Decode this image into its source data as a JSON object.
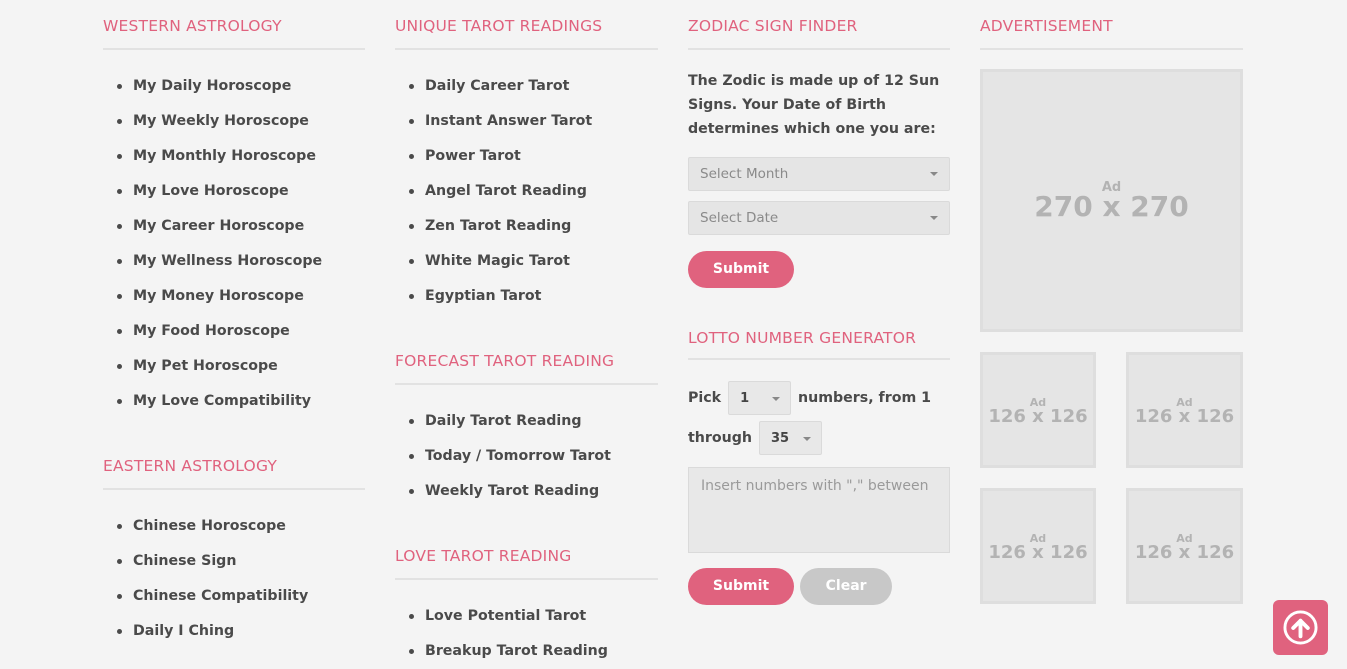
{
  "western": {
    "title": "WESTERN ASTROLOGY",
    "items": [
      "My Daily Horoscope",
      "My Weekly Horoscope",
      "My Monthly Horoscope",
      "My Love Horoscope",
      "My Career Horoscope",
      "My Wellness Horoscope",
      "My Money Horoscope",
      "My Food Horoscope",
      "My Pet Horoscope",
      "My Love Compatibility"
    ]
  },
  "eastern": {
    "title": "EASTERN ASTROLOGY",
    "items": [
      "Chinese Horoscope",
      "Chinese Sign",
      "Chinese Compatibility",
      "Daily I Ching"
    ]
  },
  "unique_tarot": {
    "title": "UNIQUE TAROT READINGS",
    "items": [
      "Daily Career Tarot",
      "Instant Answer Tarot",
      "Power Tarot",
      "Angel Tarot Reading",
      "Zen Tarot Reading",
      "White Magic Tarot",
      "Egyptian Tarot"
    ]
  },
  "forecast_tarot": {
    "title": "FORECAST TAROT READING",
    "items": [
      "Daily Tarot Reading",
      "Today / Tomorrow Tarot",
      "Weekly Tarot Reading"
    ]
  },
  "love_tarot": {
    "title": "LOVE TAROT READING",
    "items": [
      "Love Potential Tarot",
      "Breakup Tarot Reading"
    ]
  },
  "zodiac_finder": {
    "title": "ZODIAC SIGN FINDER",
    "description": "The Zodic is made up of 12 Sun Signs. Your Date of Birth determines which one you are:",
    "month_select": "Select Month",
    "date_select": "Select Date",
    "submit_label": "Submit"
  },
  "lotto": {
    "title": "LOTTO NUMBER GENERATOR",
    "pick_label": "Pick",
    "pick_value": "1",
    "numbers_from_label": "numbers, from 1",
    "through_label": "through",
    "through_value": "35",
    "textarea_placeholder": "Insert numbers with \",\" between",
    "submit_label": "Submit",
    "clear_label": "Clear"
  },
  "advertisement": {
    "title": "ADVERTISEMENT",
    "ad_tag": "Ad",
    "big_size": "270 x 270",
    "small_size": "126 x 126"
  },
  "colors": {
    "accent": "#e0627e",
    "background": "#f4f4f4"
  },
  "icons": {
    "scroll_top": "arrow-up-circle-icon"
  }
}
